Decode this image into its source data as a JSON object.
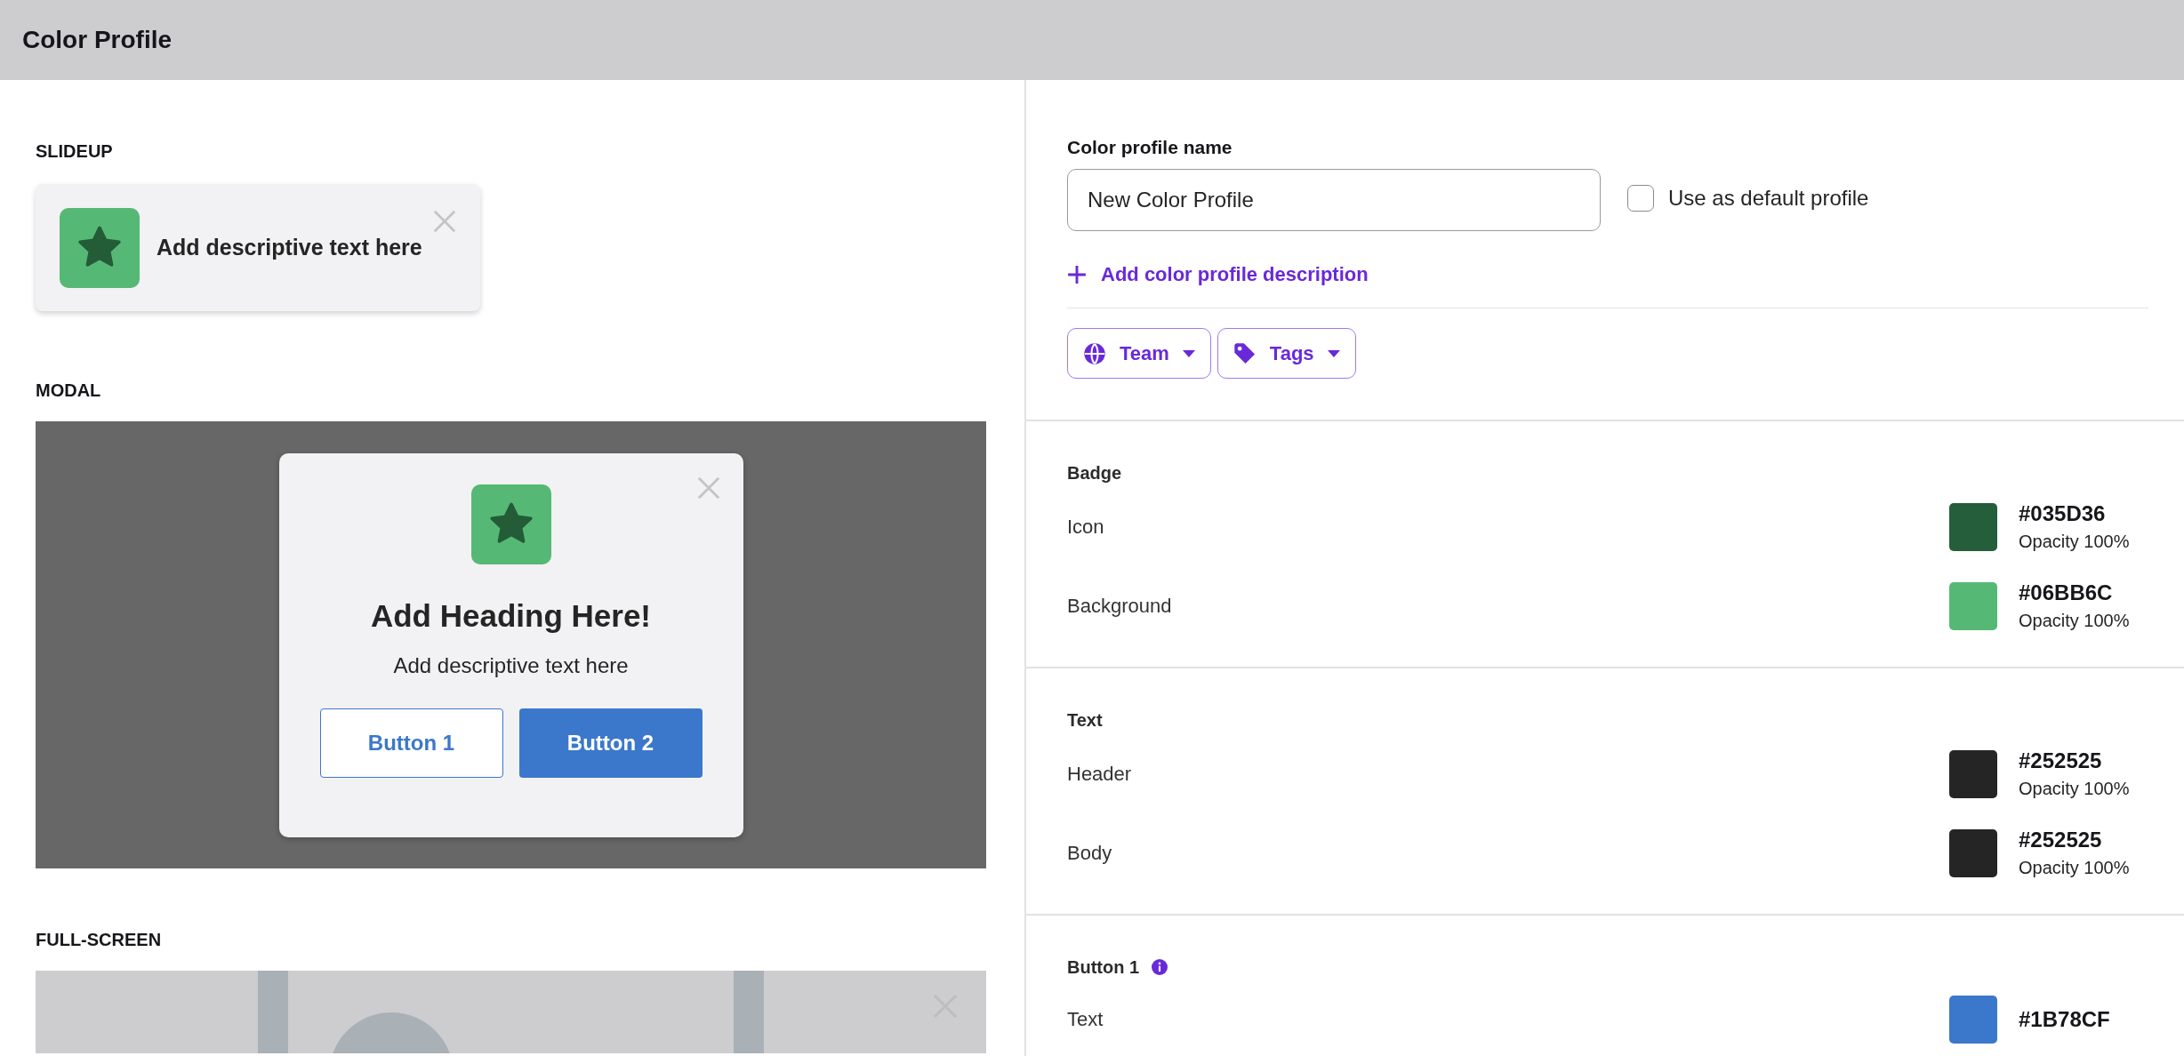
{
  "header": {
    "title": "Color Profile"
  },
  "preview": {
    "sections": [
      {
        "kind": "slideup",
        "label": "SLIDEUP",
        "text": "Add descriptive text here"
      },
      {
        "kind": "modal",
        "label": "MODAL",
        "heading": "Add Heading Here!",
        "text": "Add descriptive text here",
        "buttons": [
          {
            "label": "Button 1",
            "kind": "outline"
          },
          {
            "label": "Button 2",
            "kind": "filled"
          }
        ]
      },
      {
        "kind": "fullscreen",
        "label": "FULL-SCREEN"
      }
    ]
  },
  "settings": {
    "name_label": "Color profile name",
    "name_value": "New Color Profile",
    "default_checkbox": {
      "label": "Use as default profile",
      "checked": false
    },
    "add_description": "Add color profile description",
    "filters": [
      {
        "label": "Team",
        "kind": "globe"
      },
      {
        "label": "Tags",
        "kind": "tag"
      }
    ],
    "groups": [
      {
        "title": "Badge",
        "info": false,
        "rows": [
          {
            "label": "Icon",
            "hex": "#035D36",
            "opacity": "Opacity 100%",
            "color": "#255e3a"
          },
          {
            "label": "Background",
            "hex": "#06BB6C",
            "opacity": "Opacity 100%",
            "color": "#55b975"
          }
        ]
      },
      {
        "title": "Text",
        "info": false,
        "rows": [
          {
            "label": "Header",
            "hex": "#252525",
            "opacity": "Opacity 100%",
            "color": "#252525"
          },
          {
            "label": "Body",
            "hex": "#252525",
            "opacity": "Opacity 100%",
            "color": "#252525"
          }
        ]
      },
      {
        "title": "Button 1",
        "info": true,
        "rows": [
          {
            "label": "Text",
            "hex": "#1B78CF",
            "color": "#3b78cb"
          }
        ]
      }
    ]
  }
}
